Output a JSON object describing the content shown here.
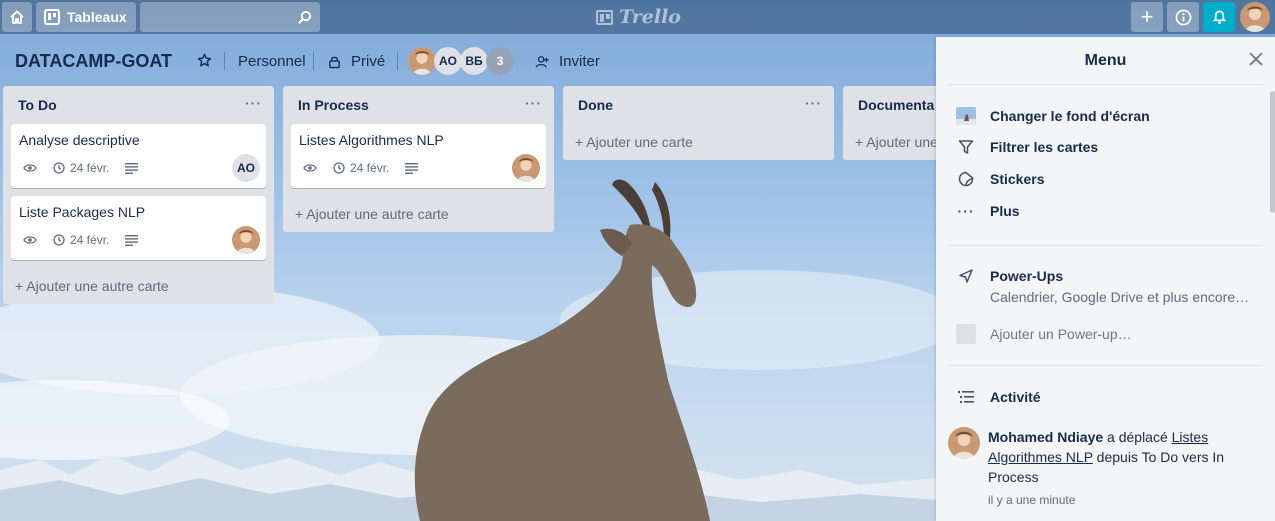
{
  "topbar": {
    "home_icon": "home-icon",
    "boards_label": "Tableaux",
    "search_value": "",
    "logo_text": "Trello",
    "colors": {
      "bell_accent": "#00aecc"
    }
  },
  "board": {
    "title": "DATACAMP-GOAT",
    "team": "Personnel",
    "visibility": "Privé",
    "members": [
      {
        "initials": "AO"
      },
      {
        "initials": "BБ"
      }
    ],
    "member_count": "3",
    "invite_label": "Inviter"
  },
  "lists": [
    {
      "name": "To Do",
      "cards": [
        {
          "title": "Analyse descriptive",
          "due": "24 févr.",
          "member": "AO"
        },
        {
          "title": "Liste Packages NLP",
          "due": "24 févr.",
          "member": ""
        }
      ],
      "add_label": "+ Ajouter une autre carte"
    },
    {
      "name": "In Process",
      "cards": [
        {
          "title": "Listes Algorithmes NLP",
          "due": "24 févr.",
          "member": ""
        }
      ],
      "add_label": "+ Ajouter une autre carte"
    },
    {
      "name": "Done",
      "cards": [],
      "add_label": "+ Ajouter une carte"
    },
    {
      "name": "Documenta",
      "cards": [],
      "add_label": "+ Ajouter une"
    }
  ],
  "menu": {
    "title": "Menu",
    "items": [
      {
        "label": "Changer le fond d'écran"
      },
      {
        "label": "Filtrer les cartes"
      },
      {
        "label": "Stickers"
      },
      {
        "label": "Plus"
      }
    ],
    "powerups": {
      "title": "Power-Ups",
      "subtitle": "Calendrier, Google Drive et plus encore…",
      "add_label": "Ajouter un Power-up…"
    },
    "activity": {
      "title": "Activité",
      "user": "Mohamed Ndiaye",
      "verb": " a déplacé ",
      "card_link": "Listes Algorithmes NLP",
      "rest": " depuis To Do vers In Process",
      "time": "il y a une minute"
    }
  }
}
